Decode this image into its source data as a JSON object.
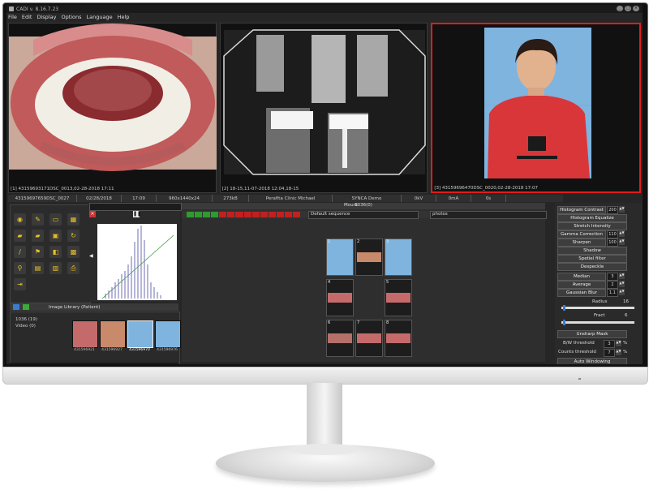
{
  "window": {
    "title": "CADI v. 8.16.7.23"
  },
  "menu": [
    "File",
    "Edit",
    "Display",
    "Options",
    "Language",
    "Help"
  ],
  "viewports": [
    {
      "caption": "[1] 43159693171DSC_0013,02-28-2018 17:11",
      "kind": "intraoral-photo"
    },
    {
      "caption": "[2] 18-15,11-07-2018 12:04,18-15",
      "kind": "xray"
    },
    {
      "caption": "[3] 43159696470DSC_0020,02-28-2018 17:07",
      "kind": "portrait"
    }
  ],
  "infobar": [
    "43159697659DSC_0027",
    "02/28/2018",
    "17:09",
    "960x1440x24",
    "273kB",
    "Perafita Clinic Michael",
    "SYNCA Demo",
    "0kV",
    "0mA",
    "0s"
  ],
  "mount": {
    "header": "1036(0)",
    "title": "Mount",
    "sequence": "Default sequence",
    "category": "photos",
    "cells": [
      "1",
      "2",
      "3",
      "4",
      "",
      "5",
      "6",
      "7",
      "8"
    ]
  },
  "library": {
    "header": "Image Library (Patient)",
    "items": [
      "1036 (19)",
      "Video (0)"
    ],
    "thumbs": [
      "431596921",
      "431596927",
      "431596970",
      "431596976"
    ]
  },
  "right_panel": {
    "histogram_contrast": {
      "label": "Histogram Contrast",
      "value": "200"
    },
    "histogram_equalize": "Histogram Equalize",
    "stretch_intensity": "Stretch Intensity",
    "gamma_correction": {
      "label": "Gamma Correction",
      "value": "110"
    },
    "sharpen": {
      "label": "Sharpen",
      "value": "100"
    },
    "shadow": "Shadow",
    "spetiel_filter": "Spetiel filter",
    "despeckle": "Despeckle",
    "median": {
      "label": "Median",
      "value": "3"
    },
    "average": {
      "label": "Average",
      "value": "2"
    },
    "gaussian_blur": {
      "label": "Gaussian Blur",
      "value": "1.1"
    },
    "radius": {
      "label": "Radius",
      "value": "16"
    },
    "fract": {
      "label": "Fract",
      "value": "6"
    },
    "unsharp_mask": "Unsharp Mask",
    "bw_threshold": {
      "label": "B/W threshold",
      "value": "3",
      "unit": "%"
    },
    "counts_threshold": {
      "label": "Counts threshold",
      "value": "7",
      "unit": "%"
    },
    "auto_windowing": "Auto Windowing"
  },
  "colors": {
    "selection": "#e01c1c",
    "tool_yellow": "#e8c22a",
    "bg": "#262626"
  }
}
